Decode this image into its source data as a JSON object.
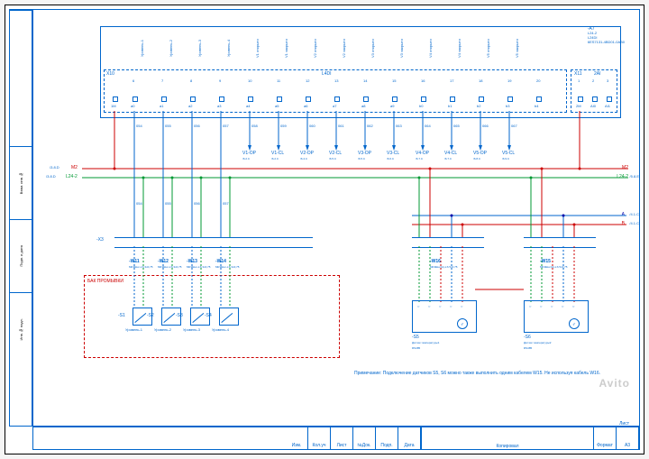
{
  "module": {
    "ref": "-A7",
    "line2": "L24-2",
    "type": "L24DI",
    "model": "6ES7131-4BD01-0AB0"
  },
  "connector_left": {
    "name": "X10",
    "title": "L4DI"
  },
  "connector_right": {
    "name": "X11",
    "title": "2AI"
  },
  "channels": [
    "Уровень-1",
    "Уровень-2",
    "Уровень-3",
    "Уровень-4",
    "V1 открыто",
    "V1 закрыто",
    "V2 открыто",
    "V2 закрыто",
    "V3 открыто",
    "V3 закрыто",
    "V4 открыто",
    "V4 закрыто",
    "V5 открыто",
    "V5 закрыто"
  ],
  "pin_nums_top": [
    "6",
    "7",
    "8",
    "9",
    "10",
    "11",
    "12",
    "13",
    "14",
    "15",
    "16",
    "17",
    "18",
    "19",
    "20"
  ],
  "pin_labels_bot": [
    "1M",
    "a0",
    "a1",
    "a2",
    "a3",
    "a4",
    "a5",
    "a6",
    "a7",
    "a8",
    "a9",
    "b0",
    "b1",
    "b2",
    "b3",
    "b4"
  ],
  "x11_pins_top": [
    "1",
    "2",
    "3"
  ],
  "x11_pins_bot": [
    "2M",
    "AI0",
    "AI1"
  ],
  "wire_nums": [
    "054",
    "055",
    "056",
    "057",
    "058",
    "059",
    "060",
    "061",
    "062",
    "063",
    "064",
    "065",
    "066",
    "067"
  ],
  "valve_tags": [
    {
      "name": "V1-OP",
      "ref": "/6.2.C"
    },
    {
      "name": "V1-CL",
      "ref": "/6.2.C"
    },
    {
      "name": "V2-OP",
      "ref": "/6.4.C"
    },
    {
      "name": "V2-CL",
      "ref": "/6.5.C"
    },
    {
      "name": "V3-OP",
      "ref": "/6.5.C"
    },
    {
      "name": "V3-CL",
      "ref": "/6.6.C"
    },
    {
      "name": "V4-OP",
      "ref": "/6.7.C"
    },
    {
      "name": "V4-CL",
      "ref": "/6.7.C"
    },
    {
      "name": "V5-OP",
      "ref": "/6.8.C"
    },
    {
      "name": "V5-CL",
      "ref": "/6.9.C"
    }
  ],
  "bus_left": [
    {
      "label": "M2",
      "ref": "/3.8.D",
      "color": "red"
    },
    {
      "label": "L24-2",
      "ref": "/3.8.D",
      "color": "green"
    }
  ],
  "bus_right": [
    {
      "label": "M2",
      "ref": "",
      "color": "red"
    },
    {
      "label": "L24-2",
      "ref": "/5.8.E",
      "color": "green"
    },
    {
      "label": "A",
      "ref": "/4.1.C",
      "color": "darkblue"
    },
    {
      "label": "B",
      "ref": "/4.1.C",
      "color": "red"
    }
  ],
  "xk": {
    "label": "-X3"
  },
  "cables": [
    {
      "name": "-W11",
      "spec": "МКЭШнг-LS 3х0,75"
    },
    {
      "name": "-W12",
      "spec": "МКЭШнг-LS 3х0,75"
    },
    {
      "name": "-W13",
      "spec": "МКЭШнг-LS 3х0,75"
    },
    {
      "name": "-W14",
      "spec": "МКЭШнг-LS 3х0,75"
    },
    {
      "name": "-W16",
      "spec": "МКЭШнг(А)-LS 5х0,75"
    },
    {
      "name": "-W15",
      "spec": "МКЭШнг(А)-LS 5х0,75"
    }
  ],
  "bak_label": "БАК ПРОМЫВКИ",
  "switches": [
    {
      "ref": "-S1",
      "name": "Уровень-1"
    },
    {
      "ref": "-S2",
      "name": "Уровень-2"
    },
    {
      "ref": "-S3",
      "name": "Уровень-3"
    },
    {
      "ref": "-S4",
      "name": "Уровень-4"
    }
  ],
  "temps": [
    {
      "ref": "-S5",
      "name": "Датчик температуры1",
      "proto": "RS485",
      "sym": "t°"
    },
    {
      "ref": "-S6",
      "name": "Датчик температуры2",
      "proto": "RS485",
      "sym": "t°"
    }
  ],
  "note": "Примечание: Подключение датчиков S5, S6 можно также выполнить одним кабелем W15. Не используя кабель W16.",
  "title_cells": [
    "Изм.",
    "Кол.уч",
    "Лист",
    "№Док.",
    "Подп.",
    "Дата"
  ],
  "title_mid": "Копировал",
  "title_right": [
    "Формат",
    "A3",
    "Лист"
  ],
  "left_strip": [
    "Инв.№ подл.",
    "Подп. и дата",
    "Взам. инв.№"
  ],
  "watermark": "Avito"
}
